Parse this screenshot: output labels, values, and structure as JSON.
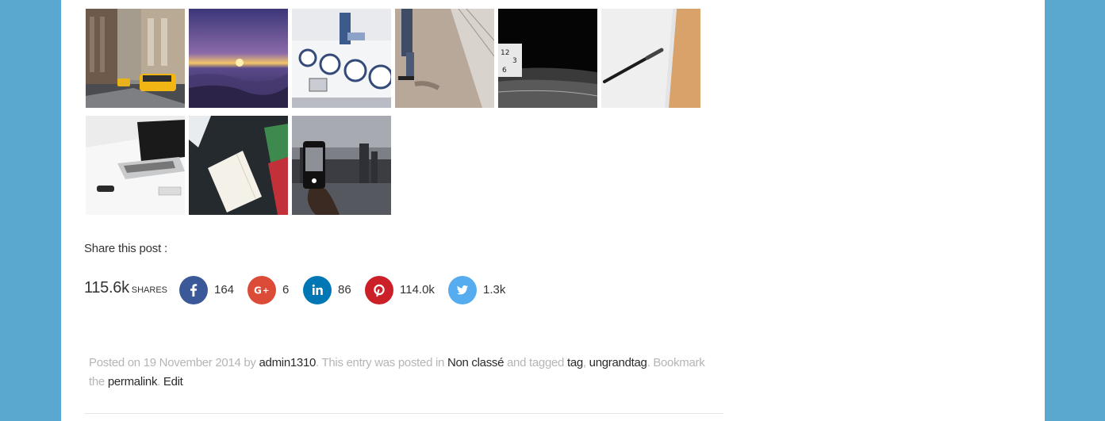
{
  "gallery": {
    "images": [
      {
        "name": "city-street-taxis-image"
      },
      {
        "name": "sunset-beach-image"
      },
      {
        "name": "laundromat-image"
      },
      {
        "name": "skateboarder-image"
      },
      {
        "name": "clock-black-image"
      },
      {
        "name": "pen-on-paper-image"
      },
      {
        "name": "laptop-desk-image"
      },
      {
        "name": "notebook-dark-desk-image"
      },
      {
        "name": "phone-photo-skyline-image"
      }
    ]
  },
  "share": {
    "label": "Share this post :",
    "total_count": "115.6k",
    "total_label": "shares",
    "networks": [
      {
        "name": "facebook",
        "icon": "facebook-icon",
        "count": "164",
        "color": "#3b5998"
      },
      {
        "name": "google-plus",
        "icon": "google-plus-icon",
        "count": "6",
        "color": "#dc4a38"
      },
      {
        "name": "linkedin",
        "icon": "linkedin-icon",
        "count": "86",
        "color": "#0077b5"
      },
      {
        "name": "pinterest",
        "icon": "pinterest-icon",
        "count": "114.0k",
        "color": "#cb2027"
      },
      {
        "name": "twitter",
        "icon": "twitter-icon",
        "count": "1.3k",
        "color": "#55acee"
      }
    ]
  },
  "meta": {
    "posted_on": "Posted on",
    "date": "19 November 2014",
    "by": "by",
    "author": "admin1310",
    "posted_in": ". This entry was posted in",
    "category": "Non classé",
    "and_tagged": "and tagged",
    "tag1": "tag",
    "comma": ",",
    "tag2": "ungrandtag",
    "bookmark": ". Bookmark the",
    "permalink": "permalink",
    "period": ".",
    "edit": "Edit"
  },
  "colors": {
    "page_background": "#5aa8cf",
    "content_background": "#ffffff",
    "meta_muted_text": "#b5b5b5"
  }
}
